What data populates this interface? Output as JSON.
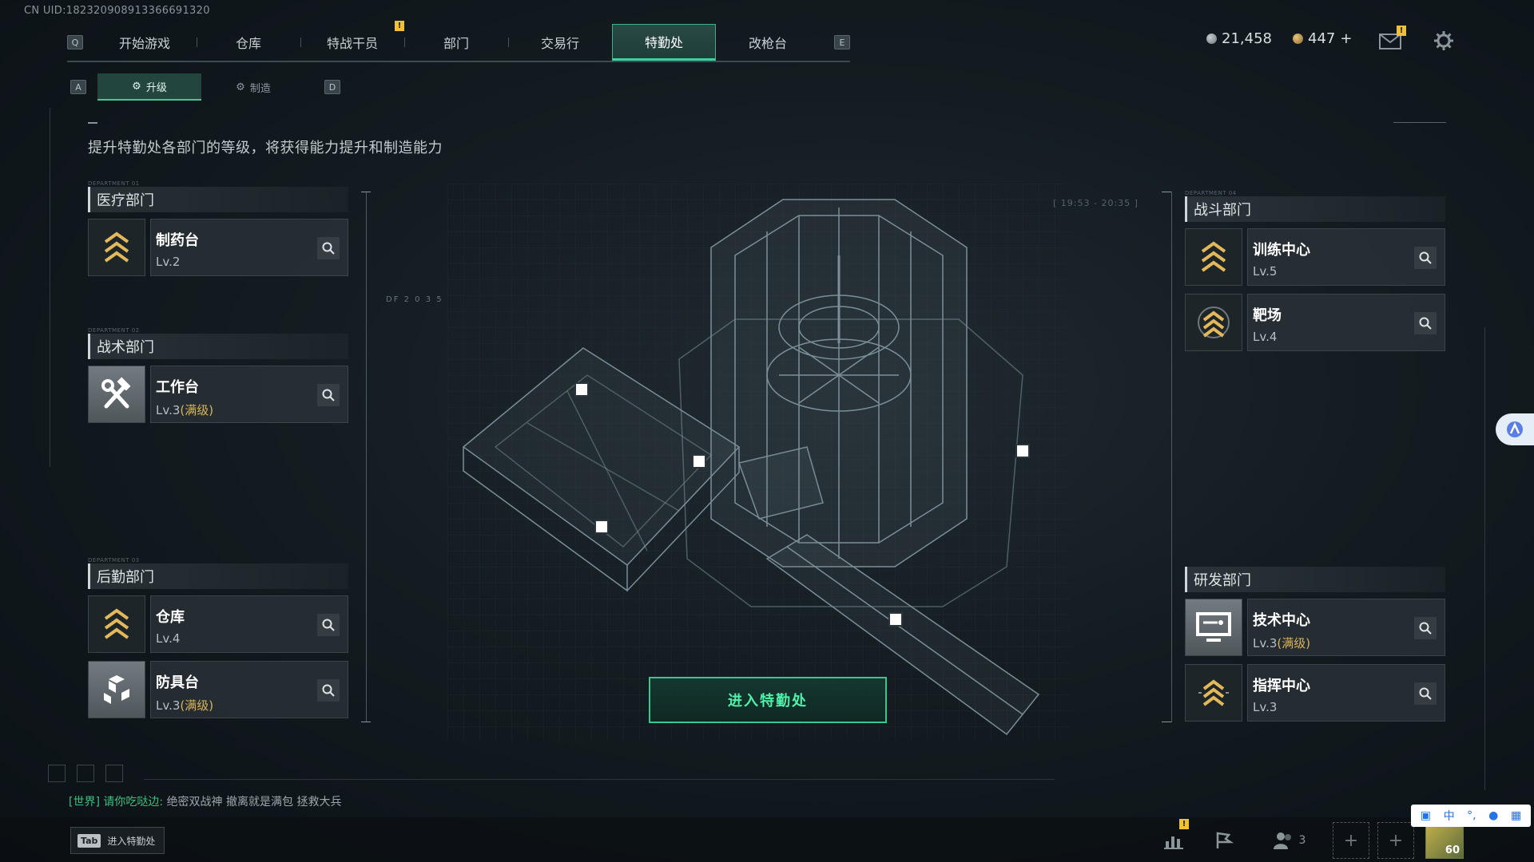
{
  "uid": "CN UID:182320908913366691320",
  "nav": {
    "left_key": "Q",
    "right_key": "E",
    "tabs": [
      {
        "label": "开始游戏",
        "active": false
      },
      {
        "label": "仓库",
        "active": false
      },
      {
        "label": "特战干员",
        "active": false,
        "alert": true
      },
      {
        "label": "部门",
        "active": false
      },
      {
        "label": "交易行",
        "active": false
      },
      {
        "label": "特勤处",
        "active": true
      },
      {
        "label": "改枪台",
        "active": false
      }
    ],
    "alert_mark": "!"
  },
  "currency": {
    "silver": "21,458",
    "gold": "447",
    "gold_add": "+"
  },
  "subtabs": {
    "left_key": "A",
    "right_key": "D",
    "upgrade": "升级",
    "craft": "制造"
  },
  "description": "提升特勤处各部门的等级，将获得能力提升和制造能力",
  "departments": {
    "medical": {
      "tag": "DEPARTMENT 01",
      "title": "医疗部门",
      "items": [
        {
          "name": "制药台",
          "level": "Lv.2",
          "max": "",
          "icon": "chevron-rank-icon"
        }
      ]
    },
    "tactical": {
      "tag": "DEPARTMENT 02",
      "title": "战术部门",
      "items": [
        {
          "name": "工作台",
          "level": "Lv.3",
          "max": "(满级)",
          "icon": "hammer-wrench-icon"
        }
      ]
    },
    "logistics": {
      "tag": "DEPARTMENT 03",
      "title": "后勤部门",
      "items": [
        {
          "name": "仓库",
          "level": "Lv.4",
          "max": "",
          "icon": "chevron-rank-icon"
        },
        {
          "name": "防具台",
          "level": "Lv.3",
          "max": "(满级)",
          "icon": "cubes-icon"
        }
      ]
    },
    "combat": {
      "tag": "DEPARTMENT 04",
      "title": "战斗部门",
      "items": [
        {
          "name": "训练中心",
          "level": "Lv.5",
          "max": "",
          "icon": "chevron-rank-icon"
        },
        {
          "name": "靶场",
          "level": "Lv.4",
          "max": "",
          "icon": "chevron-rank-icon"
        }
      ]
    },
    "research": {
      "title": "研发部门",
      "items": [
        {
          "name": "技术中心",
          "level": "Lv.3",
          "max": "(满级)",
          "icon": "monitor-icon"
        },
        {
          "name": "指挥中心",
          "level": "Lv.3",
          "max": "",
          "icon": "chevron-rank-icon"
        }
      ]
    }
  },
  "hud_text": {
    "df_code": "DF 2 0 3 5",
    "time_range": "[ 19:53 - 20:35 ]"
  },
  "enter_button": "进入特勤处",
  "chat": {
    "channel": "[世界]",
    "name": "请你吃哒边:",
    "message": "绝密双战神 撤离就是满包 拯救大兵"
  },
  "tab_hint": {
    "key": "Tab",
    "label": "进入特勤处"
  },
  "bottom": {
    "friends_count": "3",
    "level": "60"
  },
  "ime": {
    "lang": "中",
    "punct": "°,"
  },
  "colors": {
    "accent": "#41d29c",
    "max_level": "#d8b35b",
    "rank_gold": "#e2b85a"
  }
}
